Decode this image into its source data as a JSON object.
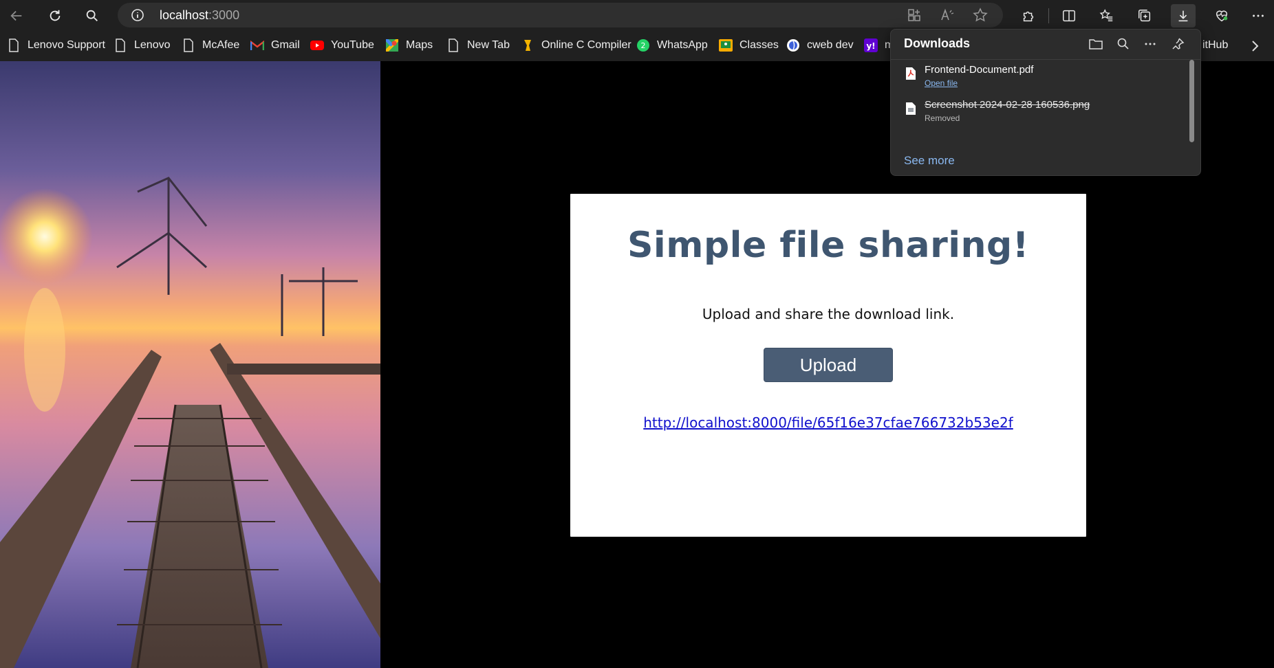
{
  "browser": {
    "url_host": "localhost",
    "url_port": ":3000"
  },
  "bookmarks": [
    {
      "label": "Lenovo Support",
      "icon": "page-icon"
    },
    {
      "label": "Lenovo",
      "icon": "page-icon"
    },
    {
      "label": "McAfee",
      "icon": "page-icon"
    },
    {
      "label": "Gmail",
      "icon": "gmail-icon"
    },
    {
      "label": "YouTube",
      "icon": "youtube-icon"
    },
    {
      "label": "Maps",
      "icon": "maps-icon"
    },
    {
      "label": "New Tab",
      "icon": "page-icon"
    },
    {
      "label": "Online C Compiler",
      "icon": "compiler-icon"
    },
    {
      "label": "WhatsApp",
      "icon": "whatsapp-icon"
    },
    {
      "label": "Classes",
      "icon": "classes-icon"
    },
    {
      "label": "cweb dev",
      "icon": "cweb-icon"
    },
    {
      "label": "m",
      "icon": "yahoo-icon"
    },
    {
      "label": "itHub",
      "icon": "github-icon"
    }
  ],
  "downloads": {
    "title": "Downloads",
    "items": [
      {
        "name": "Frontend-Document.pdf",
        "status": "Open file",
        "type": "pdf"
      },
      {
        "name": "Screenshot 2024-02-28 160536.png",
        "status": "Removed",
        "type": "image"
      }
    ],
    "see_more": "See more"
  },
  "main": {
    "title": "Simple file sharing!",
    "subtitle": "Upload and share the download link.",
    "upload_label": "Upload",
    "link": "http://localhost:8000/file/65f16e37cfae766732b53e2f"
  },
  "colors": {
    "title": "#3f5670",
    "button": "#4a5d75",
    "link": "#1010cc",
    "chrome": "#202020"
  }
}
